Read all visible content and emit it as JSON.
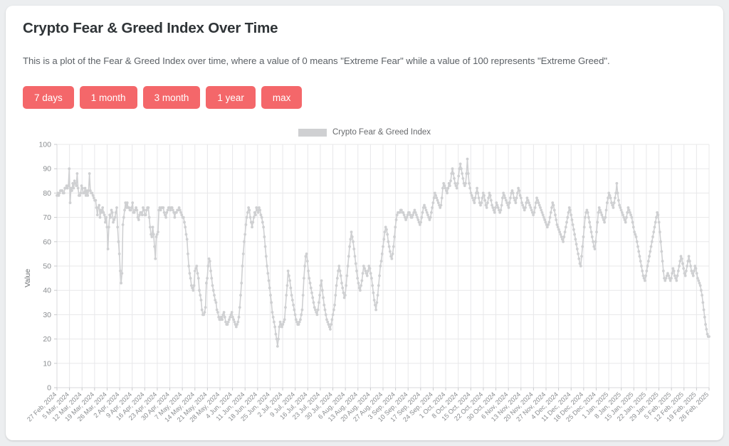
{
  "header": {
    "title": "Crypto Fear & Greed Index Over Time",
    "subtitle": "This is a plot of the Fear & Greed Index over time, where a value of 0 means \"Extreme Fear\" while a value of 100 represents \"Extreme Greed\"."
  },
  "range_buttons": [
    {
      "label": "7 days"
    },
    {
      "label": "1 month"
    },
    {
      "label": "3 month"
    },
    {
      "label": "1 year"
    },
    {
      "label": "max"
    }
  ],
  "colors": {
    "button": "#f4676a",
    "button_text": "#ffffff",
    "series": "#cfd0d2",
    "grid": "#e8e8ea",
    "card": "#ffffff",
    "page_background": "#eceef0",
    "title_text": "#2f3437",
    "axis_text": "#8a8d90"
  },
  "chart_data": {
    "type": "line",
    "title": "",
    "xlabel": "",
    "ylabel": "Value",
    "ylim": [
      0,
      100
    ],
    "ytick_labels": [
      "0",
      "10",
      "20",
      "30",
      "40",
      "50",
      "60",
      "70",
      "80",
      "90",
      "100"
    ],
    "yticks": [
      0,
      10,
      20,
      30,
      40,
      50,
      60,
      70,
      80,
      90,
      100
    ],
    "grid": true,
    "legend_position": "top-center",
    "legend": [
      "Crypto Fear & Greed Index"
    ],
    "series": [
      {
        "name": "Crypto Fear & Greed Index",
        "marker": "circle",
        "color": "#cfd0d2",
        "values": [
          79,
          80,
          79,
          80,
          81,
          81,
          81,
          80,
          80,
          82,
          82,
          83,
          82,
          83,
          90,
          76,
          82,
          81,
          84,
          82,
          85,
          84,
          83,
          88,
          82,
          79,
          79,
          80,
          83,
          82,
          80,
          80,
          82,
          79,
          81,
          79,
          81,
          88,
          81,
          80,
          80,
          79,
          78,
          77,
          77,
          74,
          71,
          74,
          75,
          70,
          73,
          72,
          74,
          72,
          71,
          68,
          70,
          66,
          57,
          66,
          71,
          70,
          73,
          72,
          68,
          69,
          70,
          72,
          74,
          66,
          60,
          55,
          48,
          43,
          47,
          67,
          70,
          73,
          76,
          74,
          76,
          74,
          74,
          73,
          73,
          74,
          76,
          72,
          72,
          73,
          74,
          73,
          70,
          69,
          71,
          72,
          72,
          71,
          74,
          73,
          71,
          71,
          73,
          74,
          74,
          70,
          66,
          63,
          62,
          66,
          63,
          58,
          53,
          62,
          63,
          64,
          73,
          74,
          73,
          74,
          74,
          74,
          72,
          71,
          70,
          72,
          73,
          74,
          74,
          73,
          74,
          74,
          73,
          72,
          70,
          72,
          72,
          73,
          73,
          74,
          73,
          72,
          71,
          70,
          70,
          68,
          66,
          63,
          61,
          55,
          50,
          47,
          45,
          42,
          41,
          40,
          42,
          48,
          49,
          50,
          47,
          45,
          40,
          38,
          36,
          32,
          30,
          30,
          31,
          33,
          43,
          45,
          50,
          53,
          52,
          48,
          45,
          42,
          40,
          38,
          36,
          35,
          32,
          31,
          29,
          28,
          28,
          29,
          28,
          30,
          31,
          29,
          27,
          26,
          26,
          27,
          28,
          29,
          30,
          31,
          29,
          28,
          27,
          26,
          25,
          26,
          27,
          29,
          33,
          38,
          43,
          50,
          55,
          60,
          63,
          67,
          70,
          72,
          74,
          73,
          70,
          68,
          66,
          68,
          70,
          72,
          71,
          74,
          73,
          72,
          74,
          73,
          71,
          70,
          68,
          66,
          62,
          58,
          54,
          50,
          47,
          44,
          41,
          38,
          35,
          31,
          29,
          27,
          25,
          22,
          20,
          17,
          20,
          25,
          27,
          26,
          25,
          26,
          27,
          28,
          33,
          38,
          42,
          48,
          46,
          44,
          41,
          38,
          36,
          34,
          32,
          30,
          28,
          27,
          26,
          26,
          27,
          28,
          30,
          32,
          38,
          45,
          50,
          54,
          55,
          52,
          48,
          45,
          43,
          41,
          39,
          37,
          35,
          33,
          32,
          31,
          30,
          32,
          35,
          38,
          42,
          44,
          40,
          37,
          34,
          32,
          30,
          28,
          27,
          26,
          25,
          24,
          26,
          28,
          30,
          32,
          34,
          38,
          42,
          45,
          48,
          50,
          48,
          46,
          43,
          41,
          39,
          37,
          38,
          42,
          46,
          50,
          54,
          58,
          61,
          64,
          62,
          60,
          57,
          54,
          51,
          48,
          45,
          43,
          41,
          40,
          42,
          44,
          47,
          50,
          49,
          48,
          47,
          46,
          48,
          50,
          49,
          47,
          45,
          42,
          39,
          36,
          34,
          32,
          35,
          38,
          42,
          46,
          50,
          52,
          55,
          58,
          61,
          64,
          66,
          65,
          63,
          60,
          58,
          56,
          54,
          53,
          55,
          58,
          62,
          66,
          69,
          71,
          72,
          72,
          72,
          73,
          73,
          72,
          72,
          71,
          70,
          69,
          70,
          71,
          72,
          72,
          71,
          70,
          70,
          71,
          72,
          73,
          72,
          71,
          70,
          69,
          68,
          67,
          68,
          70,
          72,
          74,
          75,
          74,
          73,
          72,
          71,
          70,
          69,
          70,
          72,
          74,
          76,
          78,
          80,
          79,
          78,
          77,
          76,
          75,
          74,
          75,
          78,
          82,
          84,
          83,
          82,
          81,
          80,
          82,
          84,
          83,
          85,
          88,
          90,
          88,
          86,
          84,
          83,
          82,
          84,
          87,
          90,
          92,
          90,
          88,
          86,
          84,
          83,
          84,
          88,
          94,
          88,
          84,
          82,
          80,
          79,
          78,
          77,
          76,
          78,
          80,
          82,
          80,
          78,
          76,
          75,
          76,
          78,
          80,
          79,
          77,
          75,
          74,
          76,
          78,
          80,
          79,
          77,
          75,
          74,
          73,
          72,
          74,
          76,
          75,
          74,
          73,
          72,
          73,
          75,
          78,
          80,
          79,
          78,
          77,
          76,
          75,
          74,
          76,
          78,
          80,
          81,
          80,
          78,
          77,
          76,
          78,
          80,
          82,
          81,
          79,
          78,
          76,
          75,
          74,
          73,
          74,
          76,
          78,
          77,
          76,
          75,
          74,
          73,
          72,
          71,
          72,
          74,
          76,
          78,
          77,
          76,
          75,
          74,
          73,
          72,
          71,
          70,
          69,
          68,
          67,
          66,
          67,
          68,
          70,
          72,
          74,
          76,
          75,
          73,
          71,
          69,
          67,
          66,
          65,
          64,
          63,
          62,
          61,
          60,
          62,
          64,
          66,
          68,
          70,
          72,
          74,
          73,
          71,
          69,
          67,
          65,
          63,
          61,
          59,
          57,
          55,
          53,
          51,
          50,
          54,
          58,
          62,
          66,
          70,
          72,
          73,
          72,
          70,
          68,
          66,
          64,
          62,
          60,
          58,
          57,
          60,
          64,
          68,
          72,
          74,
          73,
          72,
          71,
          70,
          69,
          68,
          70,
          73,
          76,
          78,
          80,
          79,
          78,
          76,
          75,
          74,
          76,
          78,
          80,
          84,
          80,
          77,
          75,
          74,
          73,
          72,
          71,
          70,
          69,
          68,
          70,
          72,
          74,
          73,
          72,
          71,
          70,
          68,
          66,
          64,
          63,
          62,
          60,
          58,
          56,
          54,
          52,
          50,
          48,
          46,
          45,
          44,
          46,
          48,
          50,
          52,
          54,
          56,
          58,
          60,
          62,
          64,
          66,
          68,
          70,
          72,
          71,
          68,
          64,
          60,
          56,
          52,
          48,
          45,
          44,
          45,
          46,
          47,
          46,
          45,
          44,
          45,
          47,
          49,
          48,
          46,
          45,
          44,
          46,
          48,
          50,
          52,
          54,
          53,
          51,
          49,
          47,
          46,
          48,
          50,
          52,
          54,
          52,
          50,
          48,
          47,
          46,
          48,
          50,
          49,
          47,
          45,
          44,
          43,
          42,
          40,
          38,
          35,
          32,
          29,
          26,
          24,
          22,
          21,
          21
        ]
      }
    ],
    "x_tick_labels": [
      "27 Feb, 2024",
      "5 Mar, 2024",
      "12 Mar, 2024",
      "19 Mar, 2024",
      "26 Mar, 2024",
      "2 Apr, 2024",
      "9 Apr, 2024",
      "16 Apr, 2024",
      "23 Apr, 2024",
      "30 Apr, 2024",
      "7 May, 2024",
      "14 May, 2024",
      "21 May, 2024",
      "28 May, 2024",
      "4 Jun, 2024",
      "11 Jun, 2024",
      "18 Jun, 2024",
      "25 Jun, 2024",
      "2 Jul, 2024",
      "9 Jul, 2024",
      "16 Jul, 2024",
      "23 Jul, 2024",
      "30 Jul, 2024",
      "6 Aug, 2024",
      "13 Aug, 2024",
      "20 Aug, 2024",
      "27 Aug, 2024",
      "3 Sep, 2024",
      "10 Sep, 2024",
      "17 Sep, 2024",
      "24 Sep, 2024",
      "1 Oct, 2024",
      "8 Oct, 2024",
      "15 Oct, 2024",
      "22 Oct, 2024",
      "30 Oct, 2024",
      "6 Nov, 2024",
      "13 Nov, 2024",
      "20 Nov, 2024",
      "27 Nov, 2024",
      "4 Dec, 2024",
      "11 Dec, 2024",
      "18 Dec, 2024",
      "25 Dec, 2024",
      "1 Jan, 2025",
      "8 Jan, 2025",
      "15 Jan, 2025",
      "22 Jan, 2025",
      "29 Jan, 2025",
      "5 Feb, 2025",
      "12 Feb, 2025",
      "19 Feb, 2025",
      "26 Feb, 2025"
    ]
  }
}
